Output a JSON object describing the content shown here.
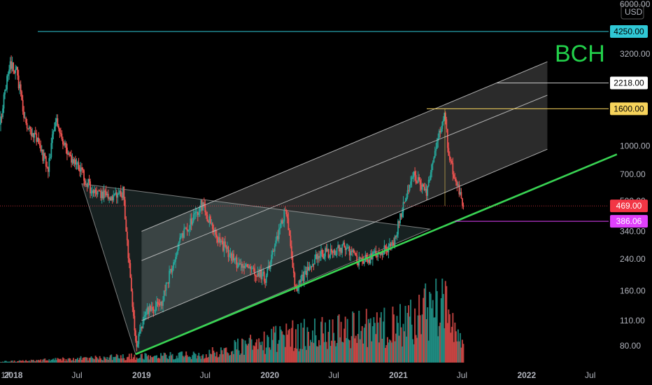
{
  "currency_label": "USD",
  "symbol_label": "BCH",
  "colors": {
    "background": "#000000",
    "up": "#26a69a",
    "down": "#ef5350",
    "trendline": "#39d353",
    "channel": "#c8c8c8",
    "resistance": "#30c8d6",
    "target_1600": "#f6d35b",
    "current": "#f23645",
    "support_386": "#e040fb",
    "title": "#22d04a"
  },
  "chart_data": {
    "type": "candlestick",
    "title": "BCH",
    "xlabel": "",
    "ylabel": "",
    "y_scale": "log",
    "ylim": [
      72,
      6000
    ],
    "xlim": [
      "2017-11-20",
      "2022-11-20"
    ],
    "y_ticks": [
      "6000.00",
      "3200.00",
      "1000.00",
      "700.00",
      "500.00",
      "340.00",
      "240.00",
      "160.00",
      "110.00",
      "80.00"
    ],
    "x_ticks": [
      {
        "date": "2017-10-01",
        "label": "17"
      },
      {
        "date": "2018-01-01",
        "label": "2018"
      },
      {
        "date": "2018-07-01",
        "label": "Jul"
      },
      {
        "date": "2019-01-01",
        "label": "2019"
      },
      {
        "date": "2019-07-01",
        "label": "Jul"
      },
      {
        "date": "2020-01-01",
        "label": "2020"
      },
      {
        "date": "2020-07-01",
        "label": "Jul"
      },
      {
        "date": "2021-01-01",
        "label": "2021"
      },
      {
        "date": "2021-07-01",
        "label": "Jul"
      },
      {
        "date": "2022-01-01",
        "label": "2022"
      },
      {
        "date": "2022-07-01",
        "label": "Jul"
      }
    ],
    "price_path": [
      {
        "date": "2017-11-20",
        "price": 1200
      },
      {
        "date": "2017-12-20",
        "price": 2800
      },
      {
        "date": "2018-01-10",
        "price": 2600
      },
      {
        "date": "2018-02-05",
        "price": 1300
      },
      {
        "date": "2018-03-01",
        "price": 1150
      },
      {
        "date": "2018-04-10",
        "price": 760
      },
      {
        "date": "2018-05-01",
        "price": 1450
      },
      {
        "date": "2018-06-01",
        "price": 950
      },
      {
        "date": "2018-07-01",
        "price": 780
      },
      {
        "date": "2018-08-15",
        "price": 560
      },
      {
        "date": "2018-10-01",
        "price": 520
      },
      {
        "date": "2018-11-10",
        "price": 560
      },
      {
        "date": "2018-12-15",
        "price": 80
      },
      {
        "date": "2019-01-15",
        "price": 125
      },
      {
        "date": "2019-03-01",
        "price": 140
      },
      {
        "date": "2019-04-15",
        "price": 290
      },
      {
        "date": "2019-06-20",
        "price": 480
      },
      {
        "date": "2019-08-01",
        "price": 320
      },
      {
        "date": "2019-10-01",
        "price": 225
      },
      {
        "date": "2019-12-20",
        "price": 190
      },
      {
        "date": "2020-02-15",
        "price": 450
      },
      {
        "date": "2020-03-15",
        "price": 165
      },
      {
        "date": "2020-05-15",
        "price": 250
      },
      {
        "date": "2020-08-01",
        "price": 280
      },
      {
        "date": "2020-09-15",
        "price": 230
      },
      {
        "date": "2020-12-15",
        "price": 280
      },
      {
        "date": "2021-01-15",
        "price": 480
      },
      {
        "date": "2021-02-15",
        "price": 700
      },
      {
        "date": "2021-03-20",
        "price": 540
      },
      {
        "date": "2021-05-12",
        "price": 1520
      },
      {
        "date": "2021-05-25",
        "price": 850
      },
      {
        "date": "2021-06-15",
        "price": 650
      },
      {
        "date": "2021-07-05",
        "price": 469
      }
    ],
    "volume_profile": [
      {
        "date": "2017-12-20",
        "rel": 0.02
      },
      {
        "date": "2018-12-15",
        "rel": 0.1
      },
      {
        "date": "2019-06-20",
        "rel": 0.12
      },
      {
        "date": "2020-03-15",
        "rel": 0.45
      },
      {
        "date": "2021-01-15",
        "rel": 0.6
      },
      {
        "date": "2021-05-12",
        "rel": 1.0
      },
      {
        "date": "2021-07-05",
        "rel": 0.2
      }
    ],
    "levels": [
      {
        "label": "4250.00",
        "price": 4250,
        "style": "line",
        "color_key": "resistance"
      },
      {
        "label": "2218.00",
        "price": 2218,
        "style": "tag",
        "color_key": "channel"
      },
      {
        "label": "1600.00",
        "price": 1600,
        "style": "tag",
        "color_key": "target_1600"
      },
      {
        "label": "469.00",
        "price": 469,
        "style": "current",
        "color_key": "current"
      },
      {
        "label": "386.06",
        "price": 386.06,
        "style": "tag",
        "color_key": "support_386"
      }
    ],
    "trendline": [
      {
        "date": "2018-12-15",
        "price": 72
      },
      {
        "date": "2022-09-15",
        "price": 900
      }
    ],
    "channel": {
      "start": "2019-01-01",
      "end": "2022-03-01",
      "lines": [
        {
          "start_price": 340,
          "end_price": 2900
        },
        {
          "start_price": 235,
          "end_price": 1900
        },
        {
          "start_price": 110,
          "end_price": 960
        }
      ]
    },
    "triangle": [
      {
        "date": "2018-07-15",
        "price": 620
      },
      {
        "date": "2018-12-15",
        "price": 72
      },
      {
        "date": "2021-04-01",
        "price": 350
      }
    ]
  }
}
